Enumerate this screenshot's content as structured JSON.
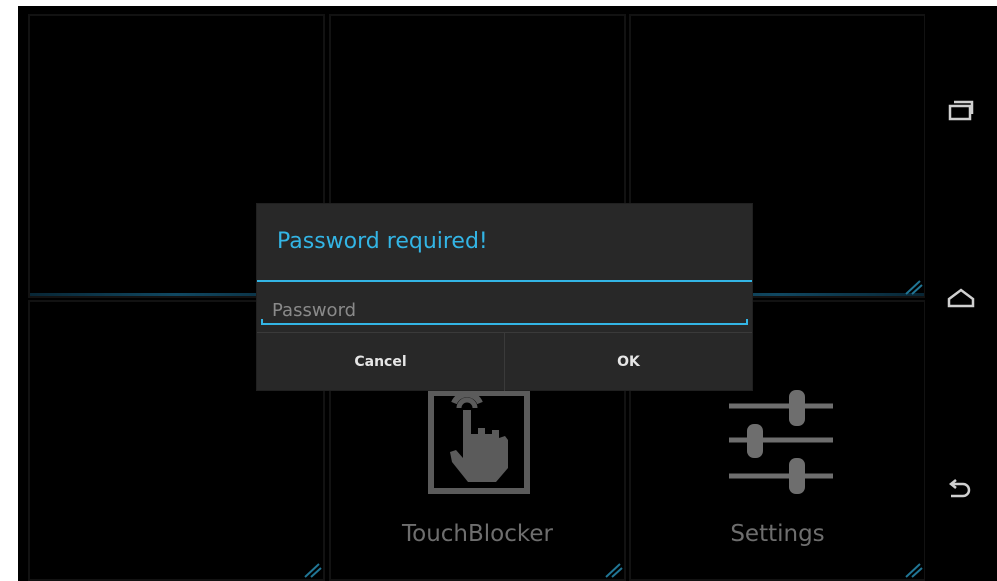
{
  "tiles": {
    "touchblocker_label": "TouchBlocker",
    "settings_label": "Settings"
  },
  "dialog": {
    "title": "Password required!",
    "password_placeholder": "Password",
    "password_value": "",
    "cancel_label": "Cancel",
    "ok_label": "OK"
  },
  "navbar": {
    "recent_icon": "recent-apps-icon",
    "home_icon": "home-icon",
    "back_icon": "back-icon"
  },
  "colors": {
    "accent": "#33b5e5",
    "tile_label": "#a9a9a9",
    "dialog_bg": "#282828"
  }
}
